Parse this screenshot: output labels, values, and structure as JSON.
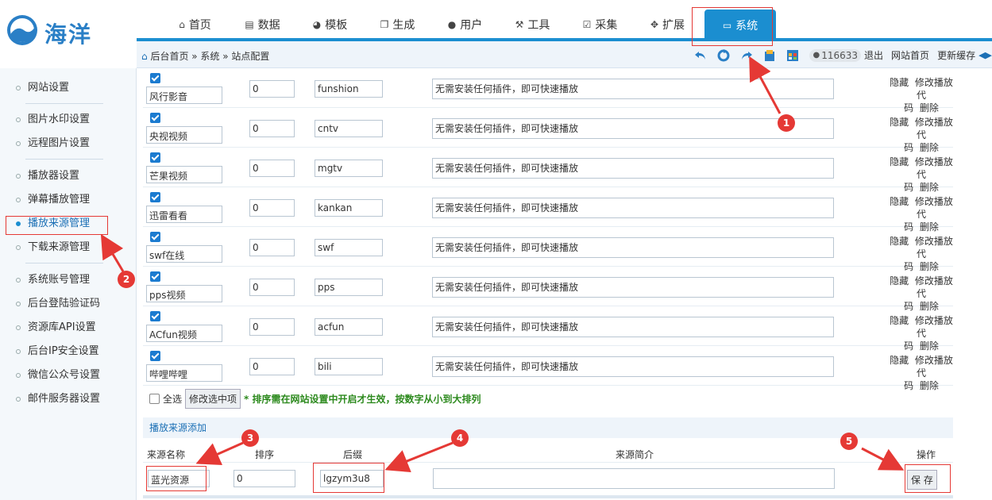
{
  "logo": {
    "text": "海洋"
  },
  "nav": [
    {
      "label": "首页",
      "icon": "home-icon",
      "glyph": "⌂"
    },
    {
      "label": "数据",
      "icon": "database-icon",
      "glyph": "▤"
    },
    {
      "label": "模板",
      "icon": "palette-icon",
      "glyph": "◕"
    },
    {
      "label": "生成",
      "icon": "copy-icon",
      "glyph": "❐"
    },
    {
      "label": "用户",
      "icon": "user-icon",
      "glyph": "●"
    },
    {
      "label": "工具",
      "icon": "tools-icon",
      "glyph": "⚒"
    },
    {
      "label": "采集",
      "icon": "check-square-icon",
      "glyph": "☑"
    },
    {
      "label": "扩展",
      "icon": "extend-icon",
      "glyph": "✥"
    },
    {
      "label": "系统",
      "icon": "monitor-icon",
      "glyph": "▭",
      "active": true
    }
  ],
  "breadcrumb": "后台首页 » 系统 » 站点配置",
  "toolbar": {
    "user_id": "116633",
    "logout": "退出",
    "site_home": "网站首页",
    "update_cache": "更新缓存"
  },
  "sidebar": [
    {
      "label": "网站设置"
    },
    {
      "label": "图片水印设置"
    },
    {
      "label": "远程图片设置"
    },
    {
      "label": "播放器设置"
    },
    {
      "label": "弹幕播放管理"
    },
    {
      "label": "播放来源管理",
      "active": true
    },
    {
      "label": "下载来源管理"
    },
    {
      "label": "系统账号管理"
    },
    {
      "label": "后台登陆验证码"
    },
    {
      "label": "资源库API设置"
    },
    {
      "label": "后台IP安全设置"
    },
    {
      "label": "微信公众号设置"
    },
    {
      "label": "邮件服务器设置"
    }
  ],
  "rows": [
    {
      "name": "风行影音",
      "sort": "0",
      "suffix": "funshion",
      "desc": "无需安装任何插件，即可快速播放"
    },
    {
      "name": "央视视频",
      "sort": "0",
      "suffix": "cntv",
      "desc": "无需安装任何插件，即可快速播放"
    },
    {
      "name": "芒果视频",
      "sort": "0",
      "suffix": "mgtv",
      "desc": "无需安装任何插件，即可快速播放"
    },
    {
      "name": "迅雷看看",
      "sort": "0",
      "suffix": "kankan",
      "desc": "无需安装任何插件，即可快速播放"
    },
    {
      "name": "swf在线",
      "sort": "0",
      "suffix": "swf",
      "desc": "无需安装任何插件，即可快速播放"
    },
    {
      "name": "pps视频",
      "sort": "0",
      "suffix": "pps",
      "desc": "无需安装任何插件，即可快速播放"
    },
    {
      "name": "ACfun视频",
      "sort": "0",
      "suffix": "acfun",
      "desc": "无需安装任何插件，即可快速播放"
    },
    {
      "name": "哔哩哔哩",
      "sort": "0",
      "suffix": "bili",
      "desc": "无需安装任何插件，即可快速播放"
    }
  ],
  "row_actions": {
    "hide": "隐藏",
    "edit_line1": "修改播放代",
    "edit_line2": "码",
    "delete": "删除"
  },
  "bulk": {
    "select_all": "全选",
    "edit_selected": "修改选中项",
    "hint": "* 排序需在网站设置中开启才生效，按数字从小到大排列"
  },
  "add": {
    "title": "播放来源添加",
    "headers": {
      "name": "来源名称",
      "sort": "排序",
      "suffix": "后缀",
      "desc": "来源简介",
      "op": "操作"
    },
    "values": {
      "name": "蓝光资源",
      "sort": "0",
      "suffix": "lgzym3u8",
      "desc": ""
    },
    "save": "保 存"
  },
  "annotations": [
    "1",
    "2",
    "3",
    "4",
    "5"
  ],
  "colors": {
    "accent": "#1b8ed0",
    "annotation": "#e53935",
    "hint": "#2d8a1e"
  }
}
